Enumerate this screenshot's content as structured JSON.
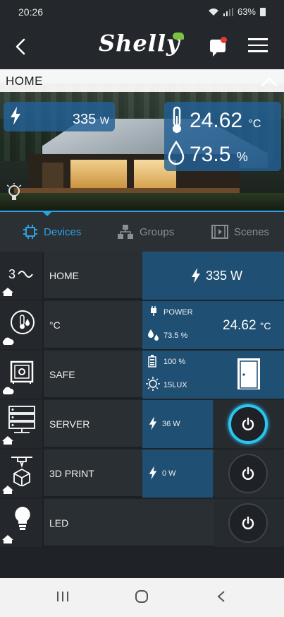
{
  "status_bar": {
    "time": "20:26",
    "battery": "63%"
  },
  "app_bar": {
    "logo_text": "Shelly"
  },
  "hero": {
    "room_title": "HOME",
    "power_value": "335",
    "power_unit": "W",
    "temperature_value": "24.62",
    "temperature_unit": "°C",
    "humidity_value": "73.5",
    "humidity_unit": "%"
  },
  "tabs": [
    {
      "label": "Devices",
      "active": true
    },
    {
      "label": "Groups",
      "active": false
    },
    {
      "label": "Scenes",
      "active": false
    }
  ],
  "devices": [
    {
      "name": "HOME",
      "icon": "three-phase-meter-icon",
      "badge": "home-icon",
      "power": "335 W"
    },
    {
      "name": "°C",
      "icon": "thermometer-icon",
      "badge": "cloud-icon",
      "power_label": "POWER",
      "humidity": "73.5 %",
      "temperature": "24.62",
      "temperature_unit": "°C"
    },
    {
      "name": "SAFE",
      "icon": "safe-icon",
      "badge": "cloud-icon",
      "battery": "100 %",
      "lux": "15LUX",
      "door_icon": "door-icon"
    },
    {
      "name": "SERVER",
      "icon": "server-icon",
      "badge": "home-icon",
      "power": "36 W",
      "switch_on": true
    },
    {
      "name": "3D PRINT",
      "icon": "3d-printer-icon",
      "badge": "home-icon",
      "power": "0 W",
      "switch_on": false
    },
    {
      "name": "LED",
      "icon": "bulb-icon",
      "badge": "home-icon",
      "switch_on": false
    }
  ],
  "colors": {
    "accent": "#2ba3e0",
    "panel_blue": "#1f4f73",
    "switch_glow": "#2bc4f2"
  }
}
